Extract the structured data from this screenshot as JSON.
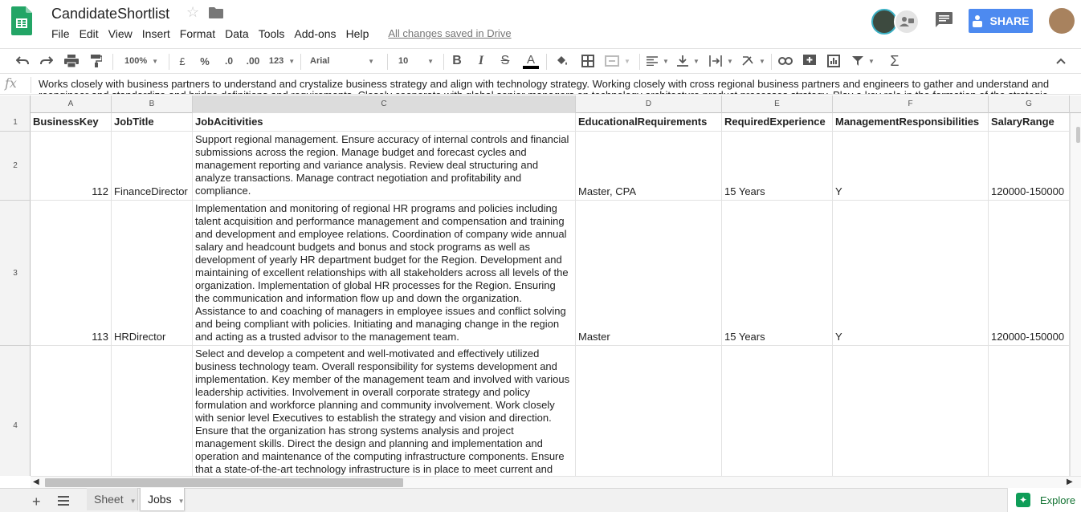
{
  "doc_title": "CandidateShortlist",
  "menu": [
    "File",
    "Edit",
    "View",
    "Insert",
    "Format",
    "Data",
    "Tools",
    "Add-ons",
    "Help"
  ],
  "saved_status": "All changes saved in Drive",
  "share_label": "SHARE",
  "accent_color": "#4d8af0",
  "toolbar": {
    "zoom": "100%",
    "currency": "£",
    "percent": "%",
    "dec_decrease": ".0",
    "dec_increase": ".00",
    "more_formats": "123",
    "font": "Arial",
    "font_size": "10",
    "bold": "B",
    "italic": "I",
    "strike": "S",
    "text_color": "A"
  },
  "formula_bar": {
    "fx": "fx",
    "content": "Works closely with business partners to understand and crystalize business strategy and align with technology strategy. Working closely with cross regional business partners and engineers to gather and understand and reengineer and standardize and bridge definitions and requirements. Closely cooperate with global senior managers on technology architecture product processes strategy. Play a key role in the formation of the strategic"
  },
  "columns": [
    "A",
    "B",
    "C",
    "D",
    "E",
    "F",
    "G"
  ],
  "selected_column": "C",
  "row_numbers": [
    "1",
    "2",
    "3",
    "4"
  ],
  "headers": [
    "BusinessKey",
    "JobTitle",
    "JobAcitivities",
    "EducationalRequirements",
    "RequiredExperience",
    "ManagementResponsibilities",
    "SalaryRange"
  ],
  "rows": [
    {
      "business_key": "112",
      "job_title": "FinanceDirector",
      "activities": "Support regional management. Ensure accuracy of internal controls and financial submissions across the region. Manage budget and forecast cycles and management reporting and variance analysis. Review deal structuring and analyze transactions. Manage contract negotiation and profitability and compliance.",
      "education": "Master, CPA",
      "experience": "15 Years",
      "management": "Y",
      "salary": "120000-150000"
    },
    {
      "business_key": "113",
      "job_title": "HRDirector",
      "activities": "Implementation and monitoring of regional HR programs and policies including talent acquisition and performance management and compensation and training and development and employee relations. Coordination of company wide annual salary and headcount budgets and bonus and stock programs as well as development of yearly HR department budget for the Region. Development and maintaining of excellent relationships with all stakeholders across all levels of the organization. Implementation of global HR processes for the Region. Ensuring the communication and information flow up and down the organization. Assistance to and coaching of managers in employee issues and conflict solving and being compliant with policies. Initiating and managing change in the region and acting as a trusted advisor to the management team.",
      "education": "Master",
      "experience": "15 Years",
      "management": "Y",
      "salary": "120000-150000"
    },
    {
      "business_key": "",
      "job_title": "",
      "activities": "Select and develop a competent and well-motivated and effectively utilized business technology team. Overall responsibility for systems development and implementation. Key member of the management team and involved with various leadership activities. Involvement in overall corporate strategy and policy formulation and workforce planning and community involvement. Work closely with senior level Executives to establish the strategy and vision and direction. Ensure that the organization has strong systems analysis and project management skills. Direct the design and planning and implementation and operation and maintenance of the computing infrastructure components. Ensure that a state-of-the-art technology infrastructure is in place to meet current and",
      "education": "",
      "experience": "",
      "management": "",
      "salary": ""
    }
  ],
  "sheet_tabs": [
    "Sheet",
    "Jobs"
  ],
  "active_tab": "Jobs",
  "explore_label": "Explore"
}
